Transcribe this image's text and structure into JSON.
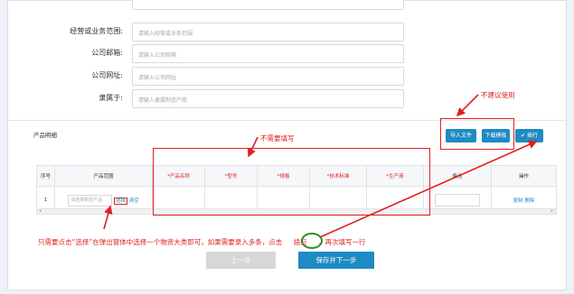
{
  "form": {
    "fields": [
      {
        "label": "经营或业务范围:",
        "placeholder": "请输入经营或业务范围"
      },
      {
        "label": "公司邮箱:",
        "placeholder": "请输入公司邮箱"
      },
      {
        "label": "公司网址:",
        "placeholder": "请输入公司网址"
      },
      {
        "label": "隶属于:",
        "placeholder": "请输入隶属制造产商"
      }
    ]
  },
  "detail": {
    "title": "产品明细",
    "buttons": {
      "import": "导入文件",
      "download": "下载模板",
      "add_row": "✔ 插行"
    }
  },
  "table": {
    "headers": [
      {
        "text": "序号",
        "required": false
      },
      {
        "text": "产品范围",
        "required": false
      },
      {
        "text": "*产品名称",
        "required": true
      },
      {
        "text": "*型号",
        "required": true
      },
      {
        "text": "*规格",
        "required": true
      },
      {
        "text": "*技术标准",
        "required": true
      },
      {
        "text": "*生产商",
        "required": true
      },
      {
        "text": "备注",
        "required": false
      },
      {
        "text": "操作",
        "required": false
      }
    ],
    "row": {
      "index": "1",
      "scope_placeholder": "请选择供应产品",
      "select_label": "选择",
      "clear_label": "清空",
      "copy_label": "复制",
      "delete_label": "删除"
    }
  },
  "annotations": {
    "not_recommended": "不建议使用",
    "no_need_fill": "不需要填写",
    "instruction_a": "只需要点击“选择”在弹出窗体中选择一个物资大类即可，如果需要录入多条，点击",
    "instruction_b": "插行",
    "instruction_c": "，再次填写一行"
  },
  "footer": {
    "prev": "上一步",
    "save_next": "保存并下一步"
  },
  "colors": {
    "primary": "#1e8bc3",
    "annotation": "#e02020",
    "circle": "#2e8b2e",
    "disabled_btn": "#d7d7d7"
  }
}
